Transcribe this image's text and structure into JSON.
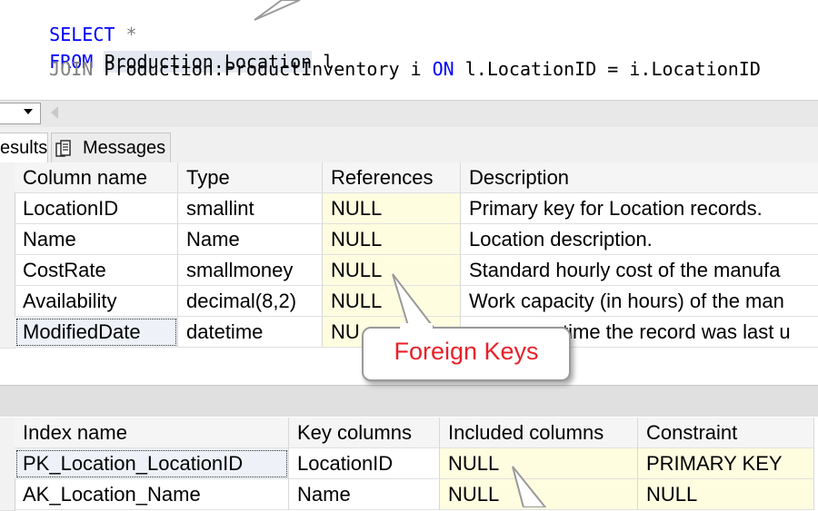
{
  "editor": {
    "line1": {
      "kw": "SELECT",
      "rest": " *"
    },
    "line2": {
      "kw": "FROM",
      "table": "Production.Location",
      "alias": " l"
    },
    "line3": {
      "join": "JOIN",
      "table": " Production.ProductInventory i ",
      "on": "ON",
      "cond": " l.LocationID = i.LocationID"
    }
  },
  "tabs": {
    "results": "esults",
    "messages": "Messages"
  },
  "columns_grid": {
    "headers": [
      "Column name",
      "Type",
      "References",
      "Description"
    ],
    "rows": [
      [
        "LocationID",
        "smallint",
        "NULL",
        "Primary key for Location records."
      ],
      [
        "Name",
        "Name",
        "NULL",
        "Location description."
      ],
      [
        "CostRate",
        "smallmoney",
        "NULL",
        "Standard hourly cost of the manufa"
      ],
      [
        "Availability",
        "decimal(8,2)",
        "NULL",
        "Work capacity (in hours) of the man"
      ],
      [
        "ModifiedDate",
        "datetime",
        "NU",
        "time the record was last u"
      ]
    ]
  },
  "index_grid": {
    "headers": [
      "Index name",
      "Key columns",
      "Included columns",
      "Constraint"
    ],
    "rows": [
      [
        "PK_Location_LocationID",
        "LocationID",
        "NULL",
        "PRIMARY KEY"
      ],
      [
        "AK_Location_Name",
        "Name",
        "NULL",
        "NULL"
      ]
    ]
  },
  "callout": {
    "text": "Foreign Keys"
  },
  "colors": {
    "keyword": "#0000ff",
    "highlight": "#fffde0",
    "callout_text": "#e8202a"
  }
}
